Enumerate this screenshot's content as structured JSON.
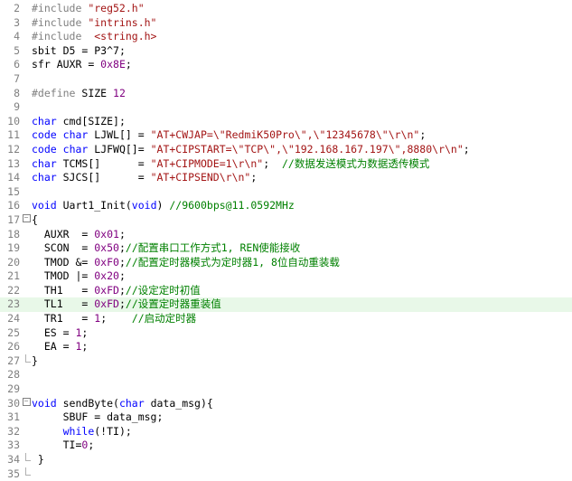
{
  "colors": {
    "keyword": "#0000ff",
    "preproc": "#808080",
    "string": "#a31515",
    "number": "#800080",
    "comment": "#008000",
    "highlight_line": "#e8f8e8"
  },
  "highlighted_line": 23,
  "lines": [
    {
      "n": "2",
      "fold": "",
      "tokens": [
        {
          "t": "#include ",
          "c": "preproc"
        },
        {
          "t": "\"reg52.h\"",
          "c": "string"
        }
      ]
    },
    {
      "n": "3",
      "fold": "",
      "tokens": [
        {
          "t": "#include ",
          "c": "preproc"
        },
        {
          "t": "\"intrins.h\"",
          "c": "string"
        }
      ]
    },
    {
      "n": "4",
      "fold": "",
      "tokens": [
        {
          "t": "#include  ",
          "c": "preproc"
        },
        {
          "t": "<string.h>",
          "c": "string"
        }
      ]
    },
    {
      "n": "5",
      "fold": "",
      "tokens": [
        {
          "t": "sbit",
          "c": "default"
        },
        {
          "t": " D5 = P3^7;",
          "c": "default"
        }
      ]
    },
    {
      "n": "6",
      "fold": "",
      "tokens": [
        {
          "t": "sfr",
          "c": "default"
        },
        {
          "t": " AUXR = ",
          "c": "default"
        },
        {
          "t": "0x8E",
          "c": "number"
        },
        {
          "t": ";",
          "c": "default"
        }
      ]
    },
    {
      "n": "7",
      "fold": "",
      "tokens": []
    },
    {
      "n": "8",
      "fold": "",
      "tokens": [
        {
          "t": "#define",
          "c": "preproc"
        },
        {
          "t": " SIZE ",
          "c": "default"
        },
        {
          "t": "12",
          "c": "number"
        }
      ]
    },
    {
      "n": "9",
      "fold": "",
      "tokens": []
    },
    {
      "n": "10",
      "fold": "",
      "tokens": [
        {
          "t": "char",
          "c": "keyword"
        },
        {
          "t": " cmd[SIZE];",
          "c": "default"
        }
      ]
    },
    {
      "n": "11",
      "fold": "",
      "tokens": [
        {
          "t": "code",
          "c": "keyword"
        },
        {
          "t": " ",
          "c": "default"
        },
        {
          "t": "char",
          "c": "keyword"
        },
        {
          "t": " LJWL[] = ",
          "c": "default"
        },
        {
          "t": "\"AT+CWJAP=\\\"RedmiK50Pro\\\",\\\"12345678\\\"\\r\\n\"",
          "c": "string"
        },
        {
          "t": ";",
          "c": "default"
        }
      ]
    },
    {
      "n": "12",
      "fold": "",
      "tokens": [
        {
          "t": "code",
          "c": "keyword"
        },
        {
          "t": " ",
          "c": "default"
        },
        {
          "t": "char",
          "c": "keyword"
        },
        {
          "t": " LJFWQ[]= ",
          "c": "default"
        },
        {
          "t": "\"AT+CIPSTART=\\\"TCP\\\",\\\"192.168.167.197\\\",8880\\r\\n\"",
          "c": "string"
        },
        {
          "t": ";",
          "c": "default"
        }
      ]
    },
    {
      "n": "13",
      "fold": "",
      "tokens": [
        {
          "t": "char",
          "c": "keyword"
        },
        {
          "t": " TCMS[]      = ",
          "c": "default"
        },
        {
          "t": "\"AT+CIPMODE=1\\r\\n\"",
          "c": "string"
        },
        {
          "t": ";  ",
          "c": "default"
        },
        {
          "t": "//数据发送模式为数据透传模式",
          "c": "comment"
        }
      ]
    },
    {
      "n": "14",
      "fold": "",
      "tokens": [
        {
          "t": "char",
          "c": "keyword"
        },
        {
          "t": " SJCS[]      = ",
          "c": "default"
        },
        {
          "t": "\"AT+CIPSEND\\r\\n\"",
          "c": "string"
        },
        {
          "t": ";",
          "c": "default"
        }
      ]
    },
    {
      "n": "15",
      "fold": "",
      "tokens": []
    },
    {
      "n": "16",
      "fold": "",
      "tokens": [
        {
          "t": "void",
          "c": "keyword"
        },
        {
          "t": " Uart1_Init(",
          "c": "default"
        },
        {
          "t": "void",
          "c": "keyword"
        },
        {
          "t": ") ",
          "c": "default"
        },
        {
          "t": "//9600bps@11.0592MHz",
          "c": "comment"
        }
      ]
    },
    {
      "n": "17",
      "fold": "open",
      "tokens": [
        {
          "t": "{",
          "c": "default"
        }
      ]
    },
    {
      "n": "18",
      "fold": "bar",
      "tokens": [
        {
          "t": "  AUXR  = ",
          "c": "default"
        },
        {
          "t": "0x01",
          "c": "number"
        },
        {
          "t": ";",
          "c": "default"
        }
      ]
    },
    {
      "n": "19",
      "fold": "bar",
      "tokens": [
        {
          "t": "  SCON  = ",
          "c": "default"
        },
        {
          "t": "0x50",
          "c": "number"
        },
        {
          "t": ";",
          "c": "default"
        },
        {
          "t": "//配置串口工作方式1, REN使能接收",
          "c": "comment"
        }
      ]
    },
    {
      "n": "20",
      "fold": "bar",
      "tokens": [
        {
          "t": "  TMOD &= ",
          "c": "default"
        },
        {
          "t": "0xF0",
          "c": "number"
        },
        {
          "t": ";",
          "c": "default"
        },
        {
          "t": "//配置定时器模式为定时器1, 8位自动重装载",
          "c": "comment"
        }
      ]
    },
    {
      "n": "21",
      "fold": "bar",
      "tokens": [
        {
          "t": "  TMOD |= ",
          "c": "default"
        },
        {
          "t": "0x20",
          "c": "number"
        },
        {
          "t": ";",
          "c": "default"
        }
      ]
    },
    {
      "n": "22",
      "fold": "bar",
      "tokens": [
        {
          "t": "  TH1   = ",
          "c": "default"
        },
        {
          "t": "0xFD",
          "c": "number"
        },
        {
          "t": ";",
          "c": "default"
        },
        {
          "t": "//设定定时初值",
          "c": "comment"
        }
      ]
    },
    {
      "n": "23",
      "fold": "bar",
      "tokens": [
        {
          "t": "  TL1   = ",
          "c": "default"
        },
        {
          "t": "0xFD",
          "c": "number"
        },
        {
          "t": ";",
          "c": "default"
        },
        {
          "t": "//设置定时器重装值",
          "c": "comment"
        }
      ]
    },
    {
      "n": "24",
      "fold": "bar",
      "tokens": [
        {
          "t": "  TR1   = ",
          "c": "default"
        },
        {
          "t": "1",
          "c": "number"
        },
        {
          "t": ";    ",
          "c": "default"
        },
        {
          "t": "//启动定时器",
          "c": "comment"
        }
      ]
    },
    {
      "n": "25",
      "fold": "bar",
      "tokens": [
        {
          "t": "  ES = ",
          "c": "default"
        },
        {
          "t": "1",
          "c": "number"
        },
        {
          "t": ";",
          "c": "default"
        }
      ]
    },
    {
      "n": "26",
      "fold": "bar",
      "tokens": [
        {
          "t": "  EA = ",
          "c": "default"
        },
        {
          "t": "1",
          "c": "number"
        },
        {
          "t": ";",
          "c": "default"
        }
      ]
    },
    {
      "n": "27",
      "fold": "end",
      "tokens": [
        {
          "t": "}",
          "c": "default"
        }
      ]
    },
    {
      "n": "28",
      "fold": "",
      "tokens": []
    },
    {
      "n": "29",
      "fold": "",
      "tokens": []
    },
    {
      "n": "30",
      "fold": "open",
      "tokens": [
        {
          "t": "void",
          "c": "keyword"
        },
        {
          "t": " sendByte(",
          "c": "default"
        },
        {
          "t": "char",
          "c": "keyword"
        },
        {
          "t": " data_msg){",
          "c": "default"
        }
      ]
    },
    {
      "n": "31",
      "fold": "bar",
      "tokens": [
        {
          "t": "     SBUF = data_msg;",
          "c": "default"
        }
      ]
    },
    {
      "n": "32",
      "fold": "bar",
      "tokens": [
        {
          "t": "     ",
          "c": "default"
        },
        {
          "t": "while",
          "c": "keyword"
        },
        {
          "t": "(!TI);",
          "c": "default"
        }
      ]
    },
    {
      "n": "33",
      "fold": "bar",
      "tokens": [
        {
          "t": "     TI=",
          "c": "default"
        },
        {
          "t": "0",
          "c": "number"
        },
        {
          "t": ";",
          "c": "default"
        }
      ]
    },
    {
      "n": "34",
      "fold": "end",
      "tokens": [
        {
          "t": " }",
          "c": "default"
        }
      ]
    },
    {
      "n": "35",
      "fold": "end2",
      "tokens": []
    }
  ]
}
